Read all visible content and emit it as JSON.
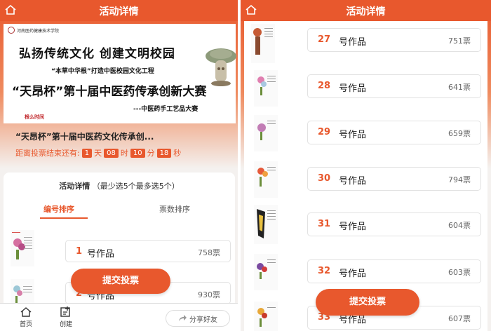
{
  "left": {
    "header_title": "活动详情",
    "banner": {
      "school": "河南医药健康技术学院",
      "line1": "弘扬传统文化  创建文明校园",
      "line2": "“本草中华根”打造中医校园文化工程",
      "line3": "“天昂杯”第十届中医药传承创新大赛",
      "line4": "---中医药手工艺品大赛",
      "stamp": "根么时间"
    },
    "info_title": "“天昂杯”第十届中医药文化传承创...",
    "countdown": {
      "label": "距离投票结束还有:",
      "days": "1",
      "days_unit": "天",
      "hours": "08",
      "hours_unit": "时",
      "minutes": "10",
      "minutes_unit": "分",
      "seconds": "18",
      "seconds_unit": "秒"
    },
    "card_title": "活动详情",
    "card_subtitle": "（最少选5个最多选5个）",
    "tabs": [
      "编号排序",
      "票数排序"
    ],
    "items": [
      {
        "num": "1",
        "label": "号作品",
        "votes": "758票"
      },
      {
        "num": "2",
        "label": "号作品",
        "votes": "930票"
      }
    ],
    "submit_label": "提交投票",
    "tabbar": {
      "home": "首页",
      "create": "创建",
      "share": "分享好友"
    }
  },
  "right": {
    "header_title": "活动详情",
    "items": [
      {
        "num": "27",
        "label": "号作品",
        "votes": "751票"
      },
      {
        "num": "28",
        "label": "号作品",
        "votes": "641票"
      },
      {
        "num": "29",
        "label": "号作品",
        "votes": "659票"
      },
      {
        "num": "30",
        "label": "号作品",
        "votes": "794票"
      },
      {
        "num": "31",
        "label": "号作品",
        "votes": "604票"
      },
      {
        "num": "32",
        "label": "号作品",
        "votes": "603票"
      },
      {
        "num": "33",
        "label": "号作品",
        "votes": "607票"
      }
    ],
    "submit_label": "提交投票"
  },
  "colors": {
    "accent": "#e8582d",
    "background": "#f4f1ef"
  }
}
